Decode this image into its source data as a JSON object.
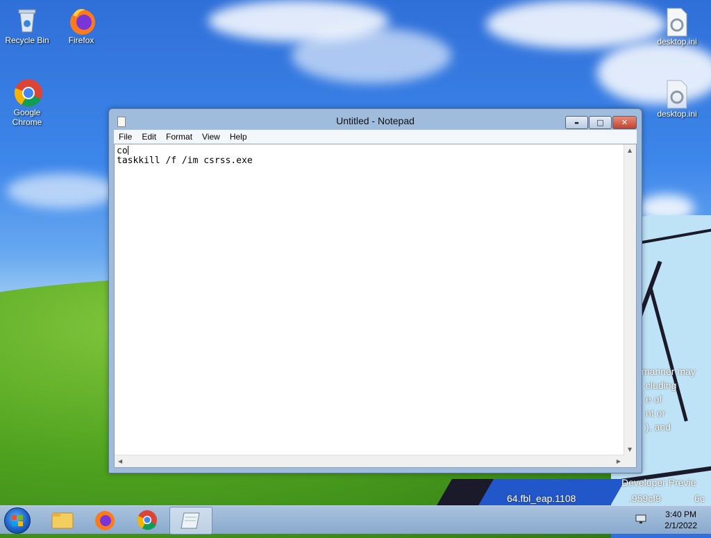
{
  "desktop": {
    "icons": [
      {
        "label": "Recycle Bin",
        "icon": "recycle-bin-icon"
      },
      {
        "label": "Firefox",
        "icon": "firefox-icon"
      },
      {
        "label": "Google Chrome",
        "icon": "chrome-icon"
      },
      {
        "label": "desktop.ini",
        "icon": "settings-file-icon"
      },
      {
        "label": "desktop.ini",
        "icon": "settings-file-icon"
      }
    ],
    "wallpaper_text": [
      "manner may",
      "cluding",
      "e of",
      "nt or",
      "), and",
      "Developer Previe",
      "64.fbl_eap.1108",
      ".959cf9",
      "6c"
    ]
  },
  "notepad": {
    "title": "Untitled - Notepad",
    "menu": [
      "File",
      "Edit",
      "Format",
      "View",
      "Help"
    ],
    "content_line1": "co",
    "content_line2": "taskkill /f /im csrss.exe",
    "buttons": {
      "minimize": "▬",
      "maximize": "□",
      "close": "✕"
    }
  },
  "taskbar": {
    "items": [
      "start-icon",
      "file-explorer-icon",
      "firefox-icon",
      "chrome-icon",
      "notepad-icon"
    ],
    "active": "notepad",
    "time": "3:40 PM",
    "date": "2/1/2022",
    "tray_icon": "network-icon"
  },
  "colors": {
    "sky": "#3d86ea",
    "grass": "#4fa21f",
    "window_frame": "#9fbcdc",
    "close_button": "#c2432c"
  }
}
